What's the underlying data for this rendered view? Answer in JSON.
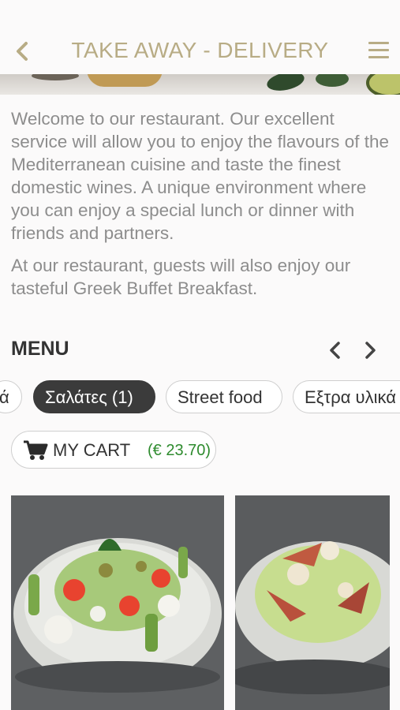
{
  "header": {
    "title": "TAKE AWAY - DELIVERY",
    "back_icon": "chevron-left-icon",
    "menu_icon": "hamburger-icon",
    "accent_color": "#b8ac85"
  },
  "intro": {
    "paragraph1": "Welcome to our restaurant. Our excellent service will allow you to enjoy the flavours of the Mediterranean cuisine and taste the finest domestic wines. A unique environment where you can enjoy a special lunch or dinner with friends and partners.",
    "paragraph2": "At our restaurant, guests will also enjoy our tasteful Greek Buffet Breakfast."
  },
  "menu": {
    "title": "MENU",
    "prev_icon": "chevron-left-icon",
    "next_icon": "chevron-right-icon",
    "categories": [
      {
        "label": "ά",
        "active": false
      },
      {
        "label": "Σαλάτες (1)",
        "active": true
      },
      {
        "label": "Street food",
        "active": false
      },
      {
        "label": "Εξτρα υλικά",
        "active": false
      }
    ]
  },
  "cart": {
    "icon": "shopping-cart-icon",
    "label": "MY CART",
    "total": "(€ 23.70)",
    "total_color": "#2e8b2e"
  }
}
